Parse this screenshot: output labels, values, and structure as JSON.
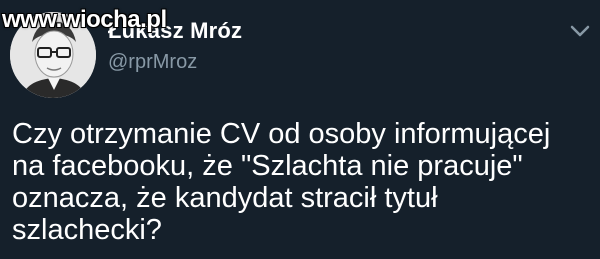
{
  "watermark": "www.wiocha.pl",
  "author": {
    "display_name": "Łukasz Mróz",
    "handle": "@rprMroz",
    "avatar_icon": "user-avatar-photo"
  },
  "menu": {
    "icon": "chevron-down-icon"
  },
  "tweet": {
    "text": "Czy otrzymanie CV od osoby informującej\nna facebooku, że \"Szlachta nie pracuje\"\noznacza, że kandydat stracił tytuł\nszlachecki?"
  },
  "colors": {
    "background": "#15202b",
    "text_primary": "#ffffff",
    "text_secondary": "#8899a6"
  }
}
